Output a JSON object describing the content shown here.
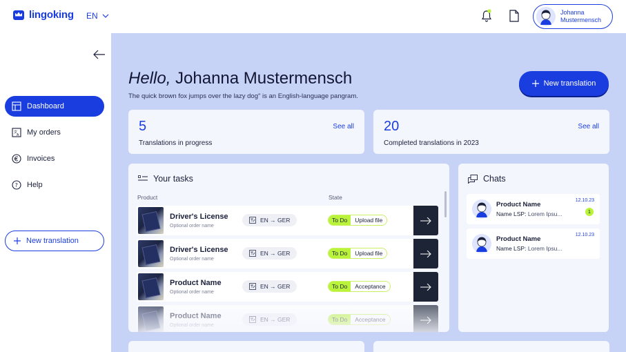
{
  "app": {
    "logo_text": "lingoking",
    "language": "EN"
  },
  "header": {
    "user": {
      "first_name": "Johanna",
      "last_name": "Mustermensch"
    },
    "notification_indicator_color": "#b9f33a"
  },
  "sidebar": {
    "items": [
      {
        "label": "Dashboard",
        "icon": "dashboard-icon",
        "active": true
      },
      {
        "label": "My orders",
        "icon": "translate-icon",
        "active": false
      },
      {
        "label": "Invoices",
        "icon": "euro-icon",
        "active": false
      },
      {
        "label": "Help",
        "icon": "help-icon",
        "active": false
      }
    ],
    "new_translation_label": "New translation"
  },
  "main": {
    "greeting_prefix": "Hello,",
    "greeting_name": "Johanna Mustermensch",
    "subtitle": "The quick brown fox jumps over the lazy dog\" is an English-language pangram.",
    "new_translation_label": "New translation",
    "stats": [
      {
        "value": "5",
        "label": "Translations in progress",
        "link": "See all"
      },
      {
        "value": "20",
        "label": "Completed translations in 2023",
        "link": "See all"
      }
    ],
    "tasks": {
      "title": "Your tasks",
      "columns": {
        "product": "Product",
        "state": "State"
      },
      "rows": [
        {
          "name": "Driver's License",
          "sub": "Optional order name",
          "lang": "EN → GER",
          "status": "To Do",
          "action": "Upload file"
        },
        {
          "name": "Driver's License",
          "sub": "Optional order name",
          "lang": "EN → GER",
          "status": "To Do",
          "action": "Upload file"
        },
        {
          "name": "Product Name",
          "sub": "Optional order name",
          "lang": "EN → GER",
          "status": "To Do",
          "action": "Acceptance"
        },
        {
          "name": "Product Name",
          "sub": "Optional order name",
          "lang": "EN → GER",
          "status": "To Do",
          "action": "Acceptance"
        }
      ]
    },
    "chats": {
      "title": "Chats",
      "items": [
        {
          "title": "Product Name",
          "lsp_label": "Name LSP:",
          "lsp_value": "Lorem Ipsu...",
          "date": "12.10.23",
          "unread": "1"
        },
        {
          "title": "Product Name",
          "lsp_label": "Name LSP:",
          "lsp_value": "Lorem Ipsu...",
          "date": "12.10.23",
          "unread": ""
        }
      ]
    }
  },
  "colors": {
    "brand": "#1a3de0",
    "accent": "#b9f33a",
    "main_bg": "#c7d2f7",
    "card_bg": "#f4f6fd"
  }
}
